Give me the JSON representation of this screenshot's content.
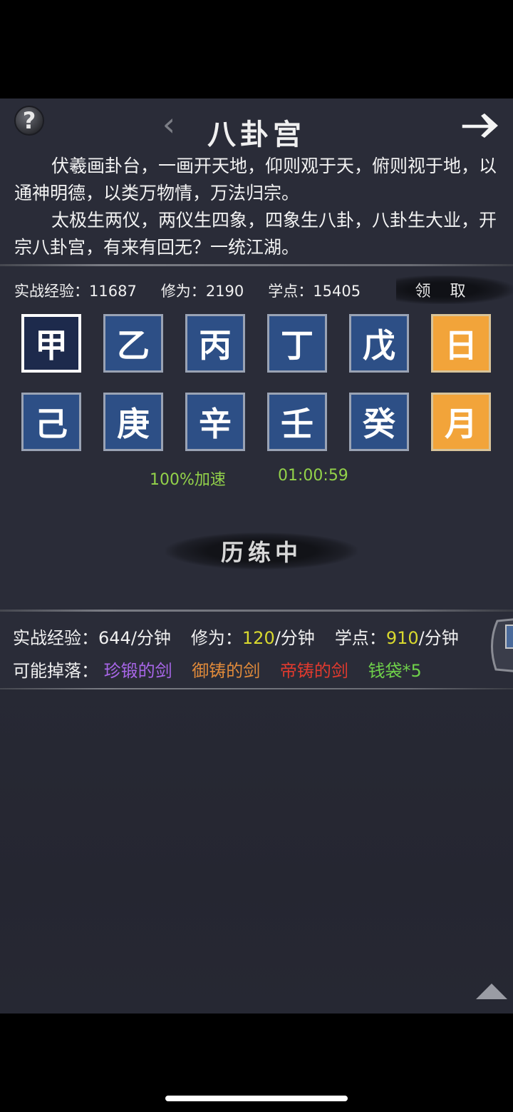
{
  "header": {
    "help_icon_text": "?",
    "back_icon_text": "‹",
    "title": "八卦宫"
  },
  "description": {
    "paragraph1": "伏羲画卦台，一画开天地，仰则观于天，俯则视于地，以通神明德，以类万物情，万法归宗。",
    "paragraph2": "太极生两仪，两仪生四象，四象生八卦，八卦生大业，开宗八卦宫，有来有回无？一统江湖。"
  },
  "stats": {
    "exp_label": "实战经验：",
    "exp_value": "11687",
    "cultivation_label": "修为：",
    "cultivation_value": "2190",
    "points_label": "学点：",
    "points_value": "15405",
    "claim_label": "领 取"
  },
  "tiles": [
    {
      "char": "甲",
      "style": "selected"
    },
    {
      "char": "乙",
      "style": "blue"
    },
    {
      "char": "丙",
      "style": "blue"
    },
    {
      "char": "丁",
      "style": "blue"
    },
    {
      "char": "戊",
      "style": "blue"
    },
    {
      "char": "日",
      "style": "gold"
    },
    {
      "char": "己",
      "style": "blue"
    },
    {
      "char": "庚",
      "style": "blue"
    },
    {
      "char": "辛",
      "style": "blue"
    },
    {
      "char": "壬",
      "style": "blue"
    },
    {
      "char": "癸",
      "style": "blue"
    },
    {
      "char": "月",
      "style": "gold"
    }
  ],
  "training": {
    "speed_text": "100%加速",
    "timer_text": "01:00:59",
    "status_text": "历练中"
  },
  "rates": {
    "exp_label": "实战经验：",
    "exp_value": "644",
    "exp_unit": "/分钟",
    "cultivation_label": "修为：",
    "cultivation_value": "120",
    "cultivation_unit": "/分钟",
    "points_label": "学点：",
    "points_value": "910",
    "points_unit": "/分钟"
  },
  "drops": {
    "label": "可能掉落：",
    "items": [
      {
        "name": "珍锻的剑",
        "color": "#a866e8"
      },
      {
        "name": "御铸的剑",
        "color": "#e08a3a"
      },
      {
        "name": "帝铸的剑",
        "color": "#e03a2e"
      },
      {
        "name": "钱袋*5",
        "color": "#6fd04a"
      }
    ]
  },
  "colors": {
    "background": "#2a2c38",
    "tile_blue": "#2d4f86",
    "tile_gold": "#f2a43a",
    "green_text": "#93d24a",
    "rate_number": "#d9d92e"
  },
  "icons": [
    "help-icon",
    "back-chevron-icon",
    "next-arrow-icon",
    "scroll-up-icon"
  ]
}
